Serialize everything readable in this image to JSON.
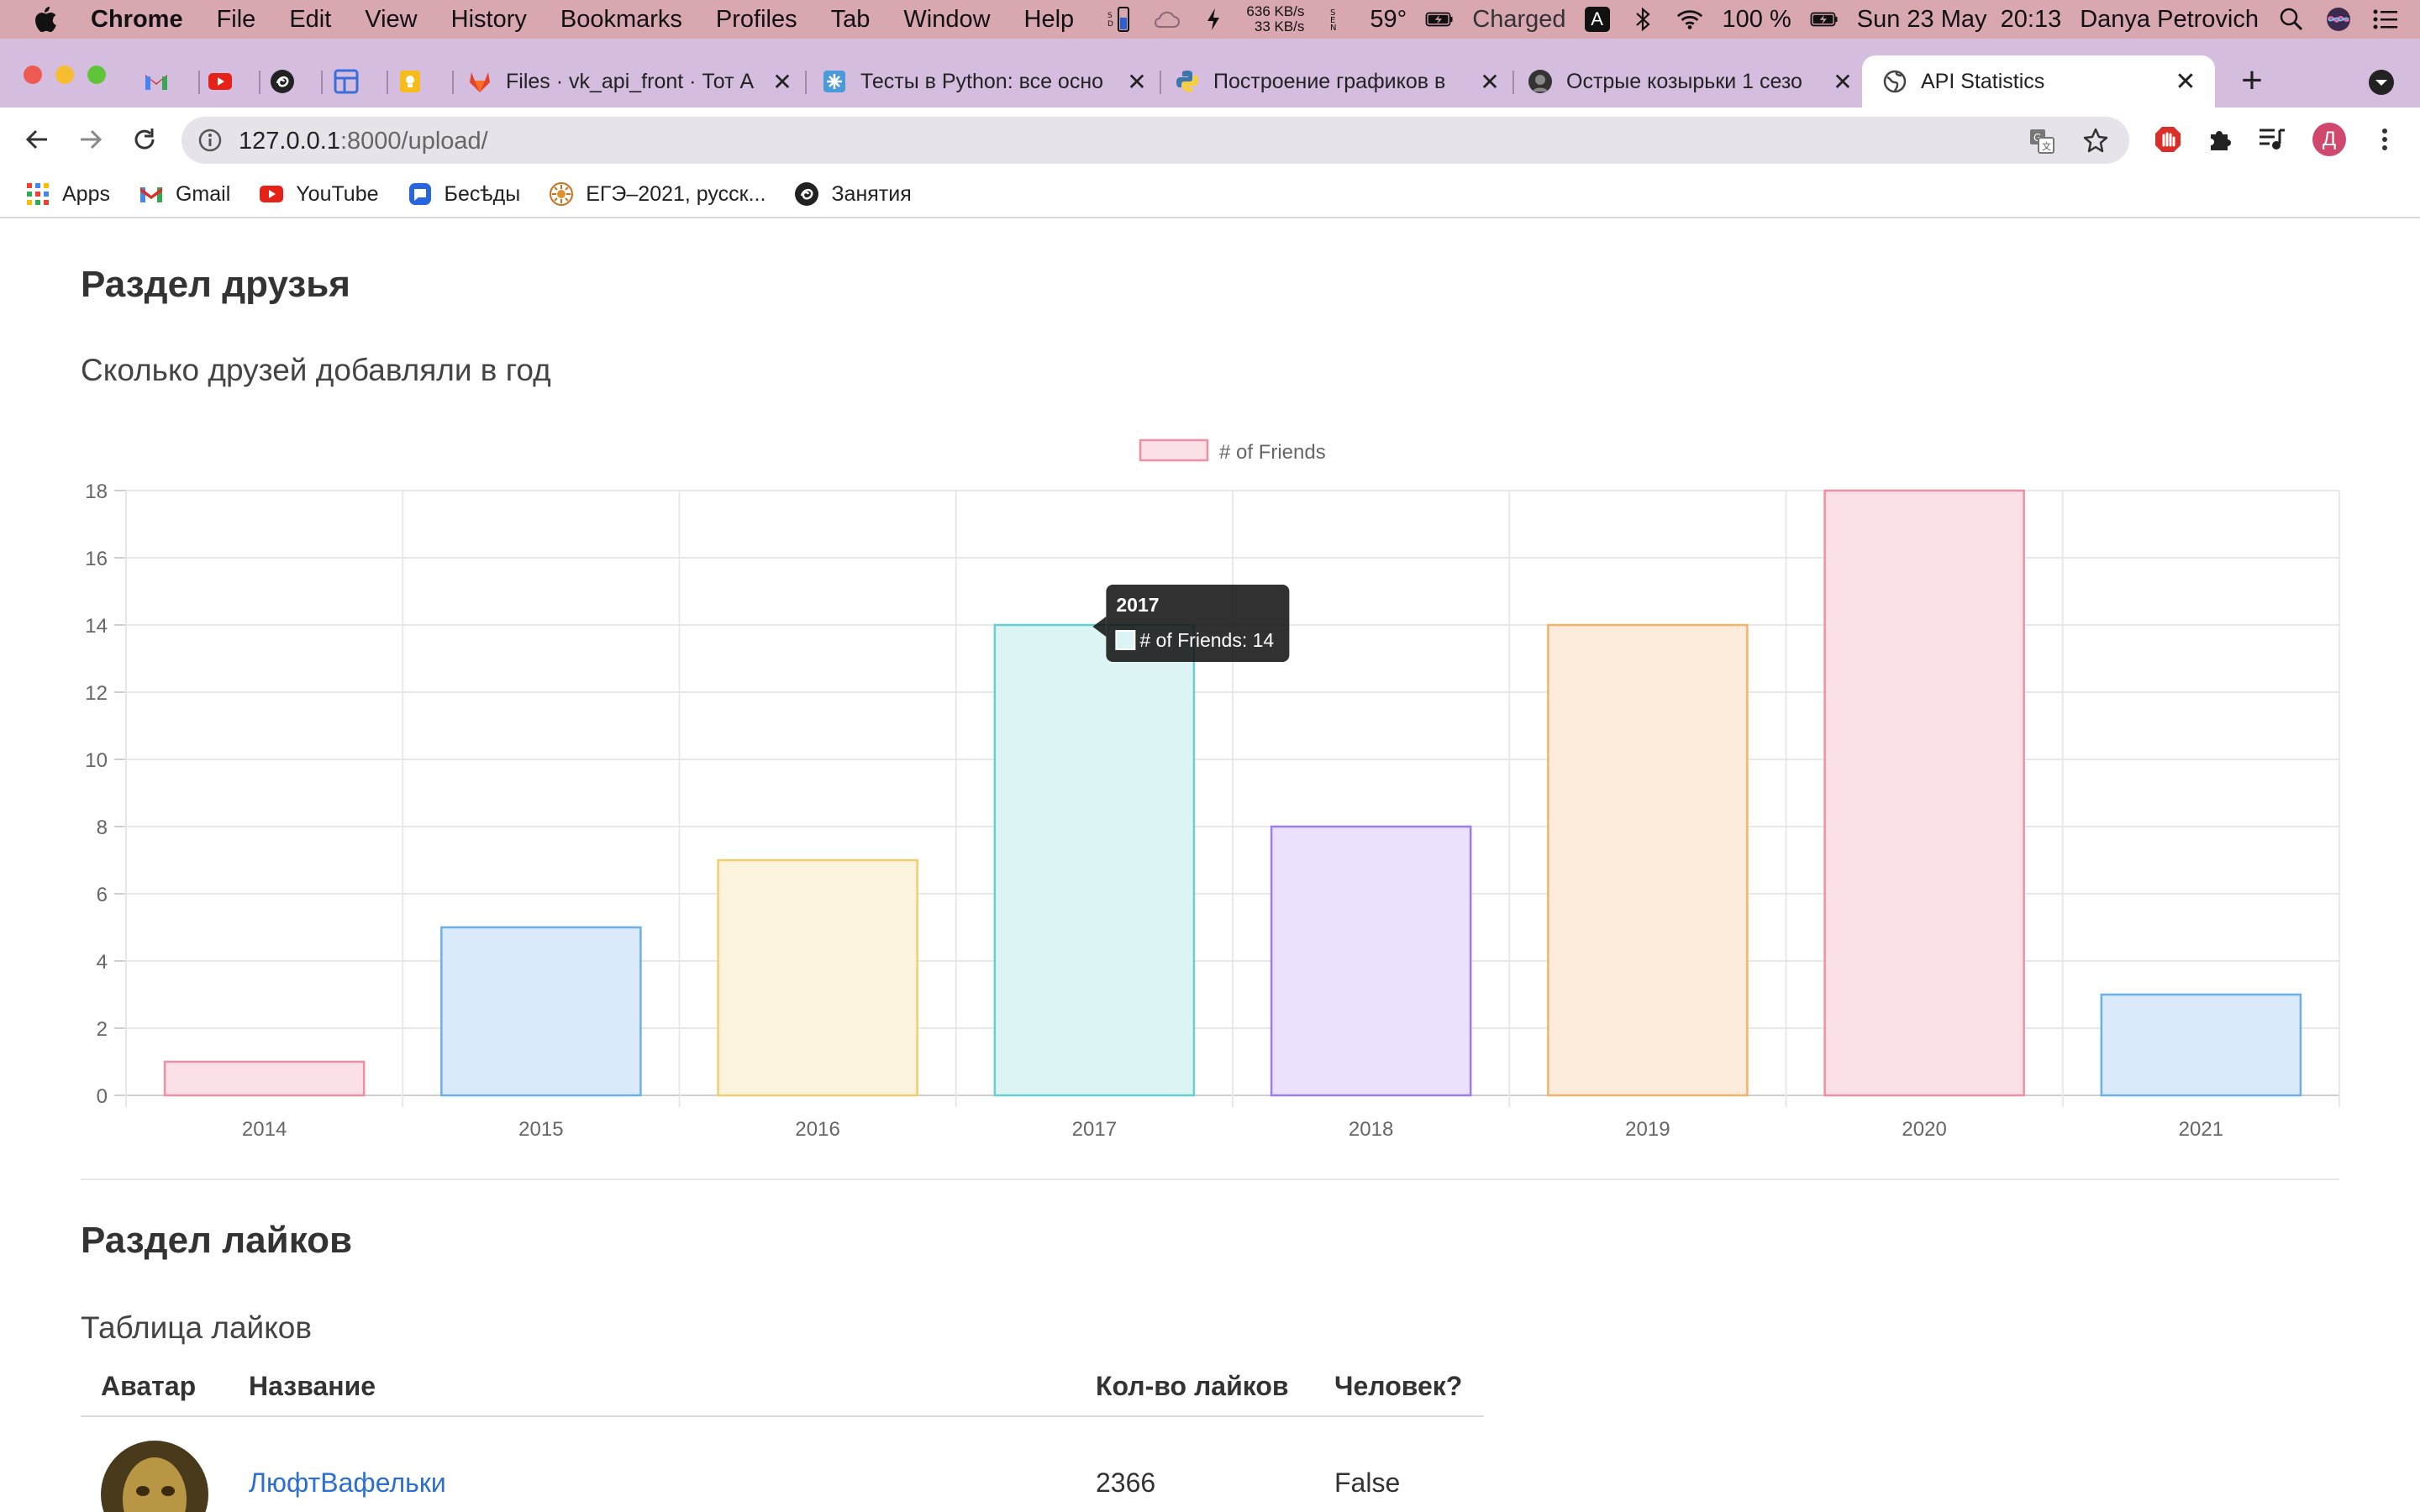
{
  "menubar": {
    "items": [
      "Chrome",
      "File",
      "Edit",
      "View",
      "History",
      "Bookmarks",
      "Profiles",
      "Tab",
      "Window",
      "Help"
    ],
    "net_up": "636 KB/s",
    "net_down": "33 KB/s",
    "temperature": "59°",
    "battery_status": "Charged",
    "battery_percent": "100 %",
    "datetime": "Sun 23 May  20:13",
    "user": "Danya Petrovich"
  },
  "tabs": [
    {
      "title": "Files · vk_api_front · Тот А",
      "icon": "gitlab-icon"
    },
    {
      "title": "Тесты в Python: все осно",
      "icon": "tests-icon"
    },
    {
      "title": "Построение графиков в",
      "icon": "python-icon"
    },
    {
      "title": "Острые козырьки 1 сезо",
      "icon": "peaky-icon"
    },
    {
      "title": "API Statistics",
      "icon": "globe-icon"
    }
  ],
  "toolbar": {
    "url_host": "127.0.0.1",
    "url_path": ":8000/upload/"
  },
  "bookmarks": [
    "Apps",
    "Gmail",
    "YouTube",
    "Бесѣды",
    "ЕГЭ–2021, русск...",
    "Занятия"
  ],
  "friends_section": {
    "heading": "Раздел друзья",
    "subheading": "Сколько друзей добавляли в год"
  },
  "chart_data": {
    "type": "bar",
    "categories": [
      "2014",
      "2015",
      "2016",
      "2017",
      "2018",
      "2019",
      "2020",
      "2021"
    ],
    "series": [
      {
        "name": "# of Friends",
        "values": [
          1,
          5,
          7,
          14,
          8,
          14,
          18,
          3
        ]
      }
    ],
    "ylim": [
      0,
      18
    ],
    "yticks": [
      0,
      2,
      4,
      6,
      8,
      10,
      12,
      14,
      16,
      18
    ],
    "grid": true,
    "legend": "top-center",
    "bar_fill": [
      "#fbe1e6",
      "#dbeafb",
      "#fcf3dc",
      "#dcf4f4",
      "#ebe1fd",
      "#fdecdb",
      "#fbe1e6",
      "#dbeafb"
    ],
    "bar_stroke": [
      "#f08fa4",
      "#6cb0e6",
      "#f5cd6f",
      "#66cfcf",
      "#9d7cf2",
      "#f5b26b",
      "#f08fa4",
      "#6cb0e6"
    ],
    "tooltip": {
      "category": "2017",
      "label": "# of Friends: 14"
    }
  },
  "likes_section": {
    "heading": "Раздел лайков",
    "subheading": "Таблица лайков",
    "columns": [
      "Аватар",
      "Название",
      "Кол-во лайков",
      "Человек?"
    ],
    "rows": [
      {
        "name": "ЛюфтВафельки",
        "likes": "2366",
        "human": "False"
      }
    ]
  }
}
